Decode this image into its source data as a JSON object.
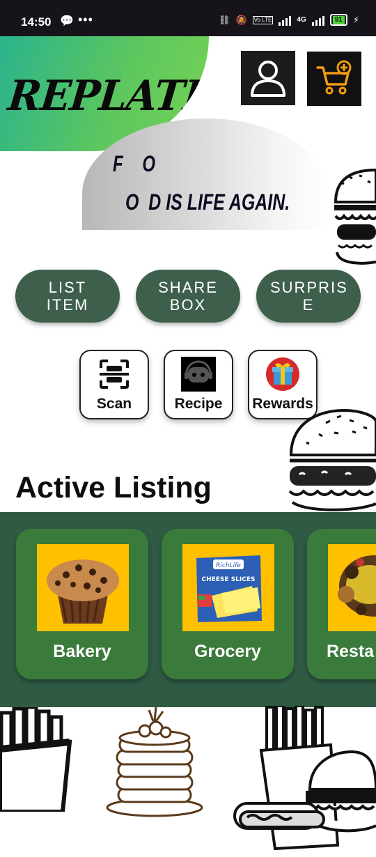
{
  "status_bar": {
    "time": "14:50",
    "network": "4G",
    "volte": "Vo LTE",
    "battery": "91"
  },
  "header": {
    "brand": "REPLATE",
    "profile_icon": "user-icon",
    "cart_icon": "cart-add-icon"
  },
  "tagline": {
    "line1": "F O",
    "line2": "O  D IS LIFE AGAIN."
  },
  "actions": [
    {
      "label": "LIST ITEM"
    },
    {
      "label": "SHARE BOX"
    },
    {
      "label": "SURPRIS E"
    }
  ],
  "tools": [
    {
      "label": "Scan",
      "icon": "scan-icon"
    },
    {
      "label": "Recipe",
      "icon": "chatbot-icon"
    },
    {
      "label": "Rewards",
      "icon": "gift-icon"
    }
  ],
  "active_listing": {
    "title": "Active Listing",
    "categories": [
      {
        "label": "Bakery",
        "image": "muffin-image"
      },
      {
        "label": "Grocery",
        "image": "cheese-slices-image",
        "package_brand": "RichLife",
        "package_text": "CHEESE SLICES"
      },
      {
        "label": "Resta",
        "image": "restaurant-food-image"
      }
    ]
  },
  "colors": {
    "accent_green": "#3e5f4c",
    "band_green": "#2f5a44",
    "card_green": "#3a7a3a",
    "image_yellow": "#ffc000",
    "cart_orange": "#f39c12"
  }
}
